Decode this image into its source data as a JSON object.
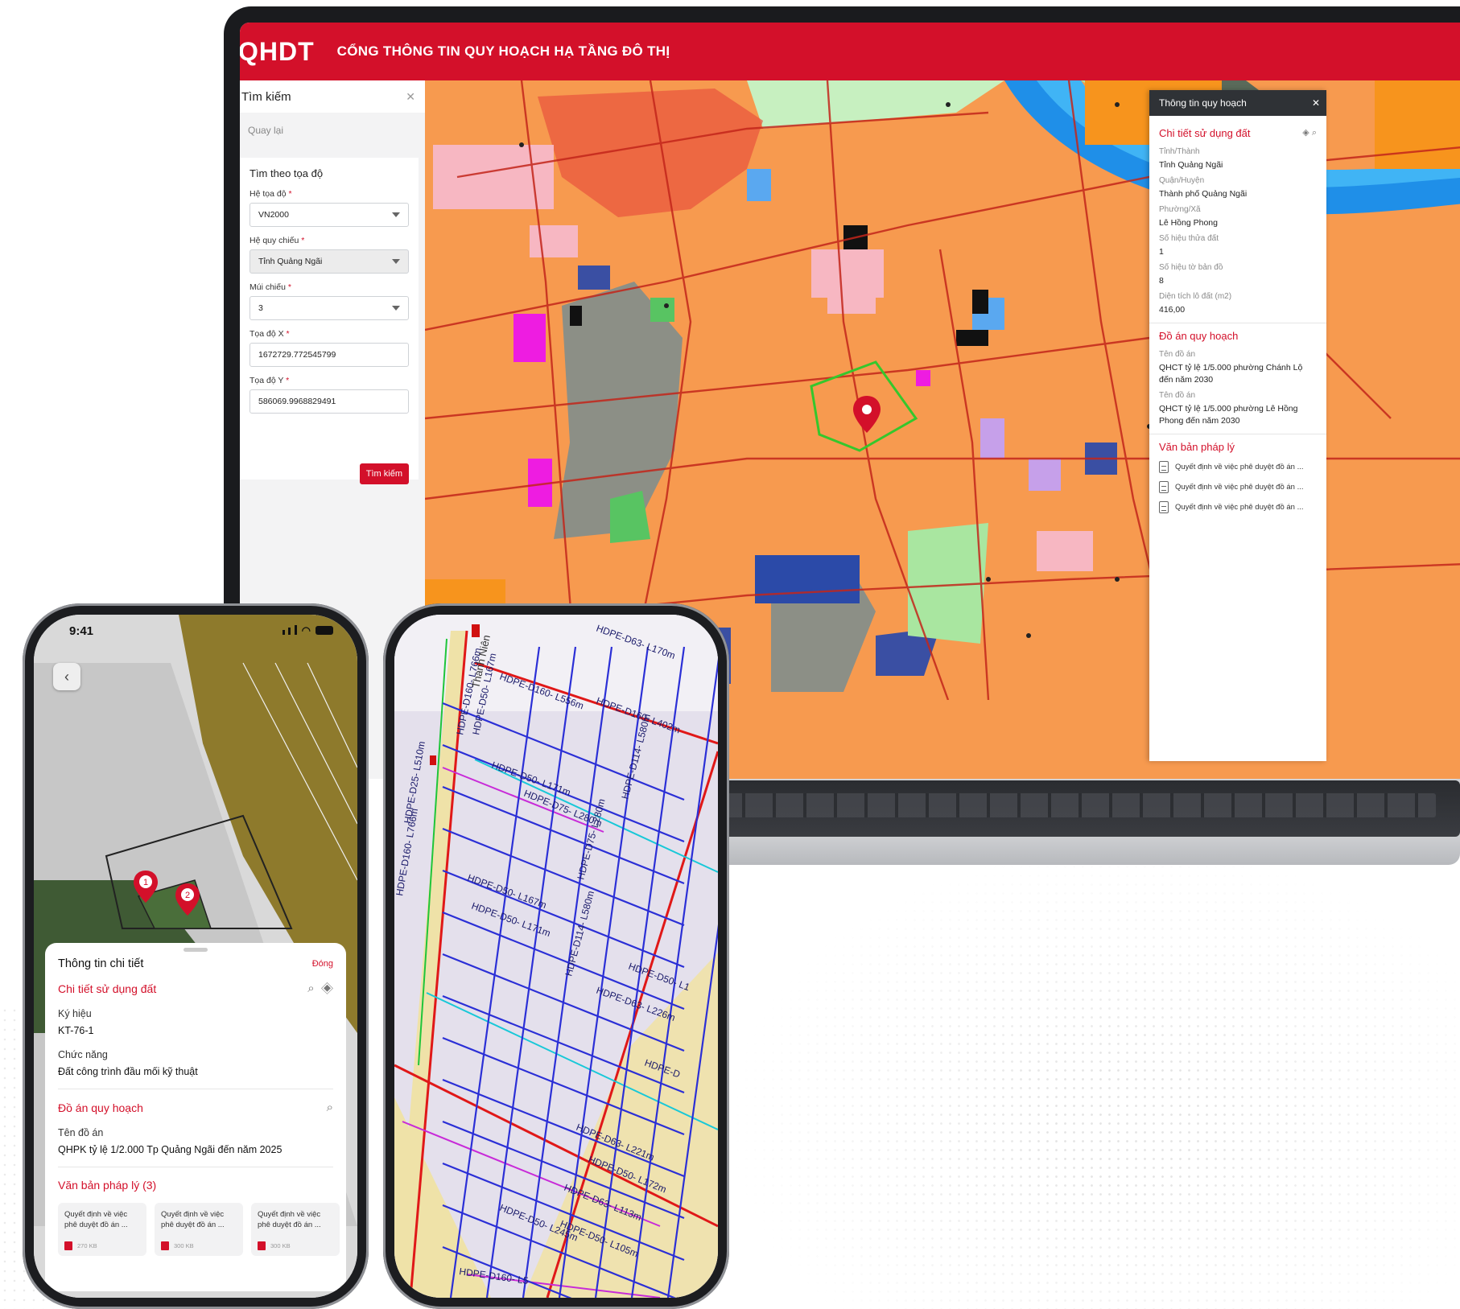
{
  "laptop": {
    "logo": "QHDT",
    "portal_title": "CỔNG THÔNG TIN QUY HOẠCH HẠ TẦNG ĐÔ THỊ",
    "search": {
      "title": "Tìm kiếm",
      "back_label": "Quay lại",
      "section_title": "Tìm theo tọa độ",
      "fields": [
        {
          "label": "Hệ tọa độ",
          "value": "VN2000"
        },
        {
          "label": "Hệ quy chiếu",
          "value": "Tỉnh Quảng Ngãi"
        },
        {
          "label": "Múi chiếu",
          "value": "3"
        },
        {
          "label": "Tọa độ X",
          "value": "1672729.772545799"
        },
        {
          "label": "Tọa độ Y",
          "value": "586069.9968829491"
        }
      ],
      "submit_label": "Tìm kiếm"
    },
    "info_panel": {
      "title": "Thông tin quy hoạch",
      "section_land": "Chi tiết sử dụng đất",
      "land_fields": [
        {
          "label": "Tỉnh/Thành",
          "value": "Tỉnh Quảng Ngãi"
        },
        {
          "label": "Quận/Huyện",
          "value": "Thành phố Quảng Ngãi"
        },
        {
          "label": "Phường/Xã",
          "value": "Lê Hồng Phong"
        },
        {
          "label": "Số hiệu thửa đất",
          "value": "1"
        },
        {
          "label": "Số hiệu tờ bản đồ",
          "value": "8"
        },
        {
          "label": "Diện tích lô đất (m2)",
          "value": "416,00"
        }
      ],
      "section_project": "Đồ án quy hoạch",
      "projects": [
        {
          "label": "Tên đồ án",
          "value": "QHCT tỷ lệ 1/5.000 phường Chánh Lộ đến năm 2030"
        },
        {
          "label": "Tên đồ án",
          "value": "QHCT tỷ lệ 1/5.000 phường Lê Hồng Phong đến năm 2030"
        }
      ],
      "section_legal": "Văn bản pháp lý",
      "legal_docs": [
        "Quyết định về việc phê duyệt đồ án ...",
        "Quyết định về việc phê duyệt đồ án ...",
        "Quyết định về việc phê duyệt đồ án ..."
      ]
    }
  },
  "phone1": {
    "time": "9:41",
    "sheet_title": "Thông tin chi tiết",
    "close_label": "Đóng",
    "section_land": "Chi tiết sử dụng đất",
    "fields": [
      {
        "label": "Ký hiệu",
        "value": "KT-76-1"
      },
      {
        "label": "Chức năng",
        "value": "Đất công trình đầu mối kỹ thuật"
      }
    ],
    "section_project": "Đồ án quy hoạch",
    "project_label": "Tên đồ án",
    "project_value": "QHPK tỷ lệ 1/2.000 Tp Quảng Ngãi đến năm 2025",
    "section_legal": "Văn bản pháp lý (3)",
    "doc_cards": [
      {
        "title": "Quyết định về việc phê duyệt đồ án ...",
        "size": "270 KB"
      },
      {
        "title": "Quyết định về việc phê duyệt đồ án ...",
        "size": "300 KB"
      },
      {
        "title": "Quyết định về việc phê duyệt đồ án ...",
        "size": "300 KB"
      }
    ],
    "pins": [
      "1",
      "2"
    ]
  },
  "phone2": {
    "road_label": "Thanh Niên",
    "pipe_labels": [
      "HDPE-D63- L170m",
      "HDPE-D160- L556m",
      "HDPE-D160- L402m",
      "HDPE-D160- L766m",
      "HDPE-D50- L167m",
      "HDPE-D50- L171m",
      "HDPE-D75- L280m",
      "HDPE-D114- L580m",
      "HDPE-D50- L167m",
      "HDPE-D50- L171m",
      "HDPE-D75- L280m",
      "HDPE-D114- L580m",
      "HDPE-D63- L226m",
      "HDPE-D50- L1",
      "HDPE-D63- L221m",
      "HDPE-D50- L172m",
      "HDPE-D63- L113m",
      "HDPE-D50- L245m",
      "HDPE-D50- L105m",
      "HDPE-D160- L5",
      "HDPE-D",
      "HDPE-D25- L510m",
      "HDPE-D160- L766m"
    ]
  },
  "colors": {
    "brand_red": "#d3102a",
    "map_orange": "#f79a4f",
    "pipe_blue": "#2b2fd6"
  }
}
